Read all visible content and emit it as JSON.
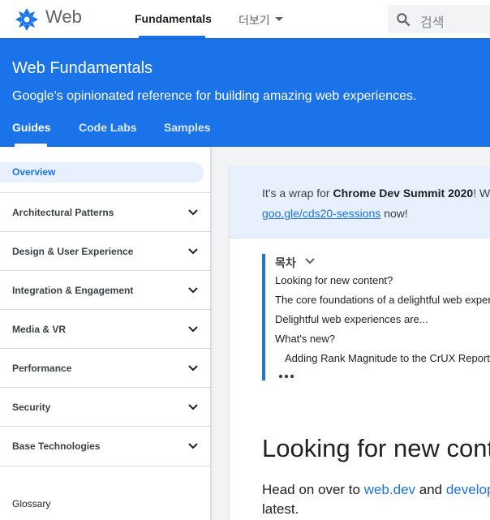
{
  "topbar": {
    "logo_text": "Web",
    "tabs": [
      {
        "label": "Fundamentals"
      },
      {
        "label": "더보기"
      }
    ],
    "search_placeholder": "검색"
  },
  "hero": {
    "title": "Web Fundamentals",
    "subtitle": "Google's opinionated reference for building amazing web experiences.",
    "tabs": [
      {
        "label": "Guides"
      },
      {
        "label": "Code Labs"
      },
      {
        "label": "Samples"
      }
    ]
  },
  "sidebar": {
    "overview": "Overview",
    "items": [
      {
        "label": "Architectural Patterns"
      },
      {
        "label": "Design & User Experience"
      },
      {
        "label": "Integration & Engagement"
      },
      {
        "label": "Media & VR"
      },
      {
        "label": "Performance"
      },
      {
        "label": "Security"
      },
      {
        "label": "Base Technologies"
      }
    ],
    "glossary": "Glossary"
  },
  "banner": {
    "prefix": "It's a wrap for ",
    "event": "Chrome Dev Summit 2020",
    "suffix": "! Wa",
    "link": "goo.gle/cds20-sessions",
    "link_suffix": " now!"
  },
  "toc": {
    "title": "목차",
    "items": [
      {
        "label": "Looking for new content?"
      },
      {
        "label": "The core foundations of a delightful web experience"
      },
      {
        "label": "Delightful web experiences are..."
      },
      {
        "label": "What's new?"
      },
      {
        "label": "Adding Rank Magnitude to the CrUX Report in BigQuery"
      }
    ]
  },
  "article": {
    "heading": "Looking for new content?",
    "para_prefix": "Head on over to ",
    "link1": "web.dev",
    "para_mid": " and ",
    "link2": "developers.chrome.com",
    "para_line2": "latest."
  },
  "colors": {
    "accent": "#1a73e8",
    "overview_bg": "#e8f0fe"
  }
}
